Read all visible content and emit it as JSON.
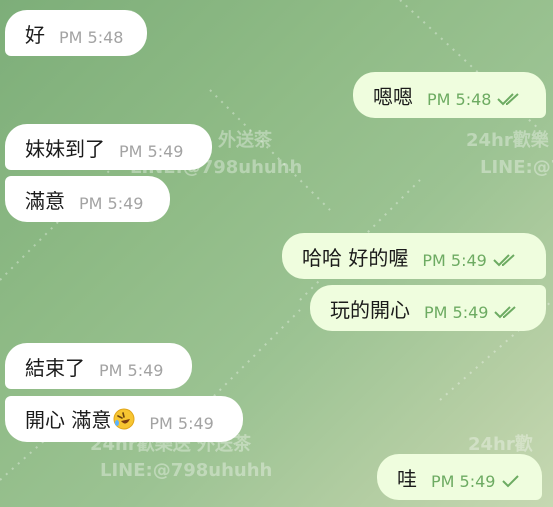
{
  "watermarks": [
    "外送茶",
    "24hr歡樂",
    "LINE:@798uhuhh",
    "LINE:@7",
    "24hr歡樂送 外送茶",
    "LINE:@798uhuhh",
    "24hr歡"
  ],
  "messages": [
    {
      "dir": "in",
      "text": "好",
      "time": "PM 5:48"
    },
    {
      "dir": "out",
      "text": "嗯嗯",
      "time": "PM 5:48",
      "status": "read-double-check-icon"
    },
    {
      "dir": "in",
      "text": "妹妹到了",
      "time": "PM 5:49"
    },
    {
      "dir": "in",
      "text": "滿意",
      "time": "PM 5:49"
    },
    {
      "dir": "out",
      "text": "哈哈 好的喔",
      "time": "PM 5:49",
      "status": "read-double-check-icon"
    },
    {
      "dir": "out",
      "text": "玩的開心",
      "time": "PM 5:49",
      "status": "read-double-check-icon"
    },
    {
      "dir": "in",
      "text": "結束了",
      "time": "PM 5:49"
    },
    {
      "dir": "in",
      "text": "開心 滿意",
      "emoji": "rofl-emoji-icon",
      "time": "PM 5:49"
    },
    {
      "dir": "out",
      "text": "哇",
      "time": "PM 5:49",
      "status": "sent-single-check-icon"
    }
  ],
  "colors": {
    "incoming_bubble": "#ffffff",
    "outgoing_bubble": "#effdde",
    "outgoing_time": "#6dab62",
    "incoming_time": "#a3a3a3",
    "check": "#6dab62"
  }
}
